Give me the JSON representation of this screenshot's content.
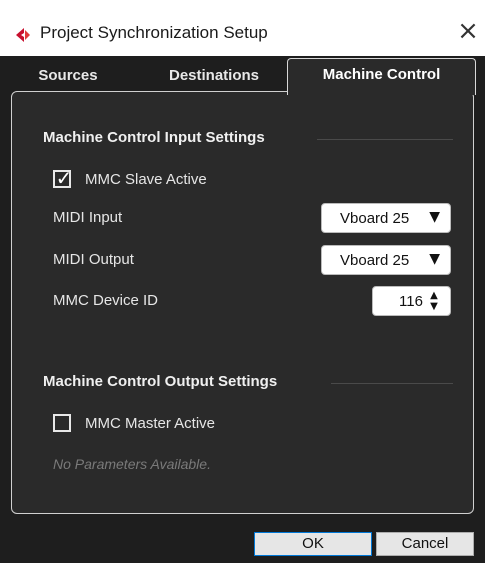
{
  "window": {
    "title": "Project Synchronization Setup",
    "close_glyph": "×",
    "logo_color": "#c8102e"
  },
  "tabs": [
    {
      "label": "Sources",
      "active": false
    },
    {
      "label": "Destinations",
      "active": false
    },
    {
      "label": "Machine Control",
      "active": true
    }
  ],
  "input_settings": {
    "header": "Machine Control Input Settings",
    "slave_active": {
      "label": "MMC Slave Active",
      "checked": true,
      "check_glyph": "✓"
    },
    "midi_input": {
      "label": "MIDI Input",
      "value": "Vboard 25",
      "arrow": "▼"
    },
    "midi_output": {
      "label": "MIDI Output",
      "value": "Vboard 25",
      "arrow": "▼"
    },
    "device_id": {
      "label": "MMC Device ID",
      "value": "116",
      "up": "▲",
      "down": "▼"
    }
  },
  "output_settings": {
    "header": "Machine Control Output Settings",
    "master_active": {
      "label": "MMC Master Active",
      "checked": false
    },
    "no_params_text": "No Parameters Available."
  },
  "footer": {
    "ok_label": "OK",
    "cancel_label": "Cancel"
  }
}
